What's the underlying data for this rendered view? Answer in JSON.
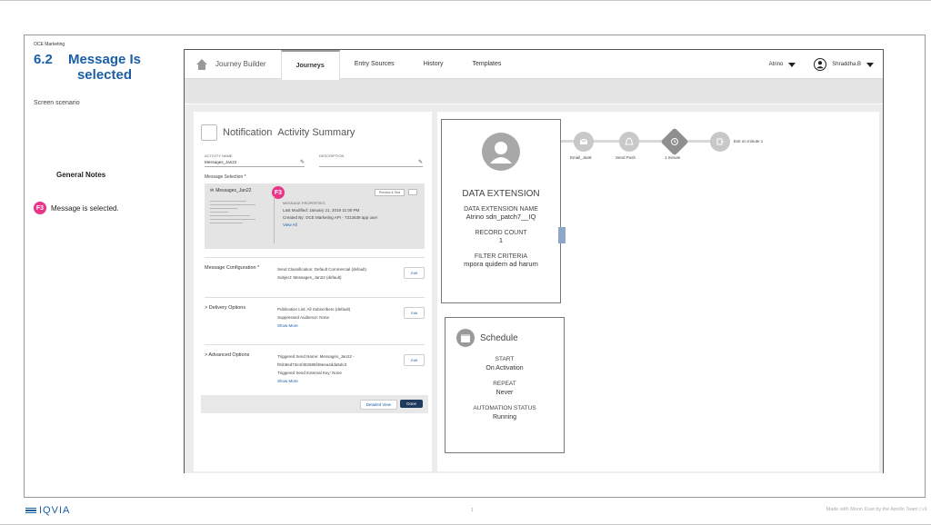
{
  "slide": {
    "app_name": "OCE Marketing",
    "number": "6.2",
    "title": "Message Is selected",
    "scenario": "Screen scenario",
    "general_notes": "General Notes",
    "note_badge": "F3",
    "note_text": "Message is selected.",
    "page_num": "1",
    "made_with": "Made with Moon Dust by the Apollo Team  |  v1",
    "logo_text": "IQVIA"
  },
  "nav": {
    "brand": "Journey Builder",
    "tabs": [
      "Journeys",
      "Entry Sources",
      "History",
      "Templates"
    ],
    "active_tab": "Journeys",
    "org": "Atrino",
    "user": "Shraddha.B"
  },
  "summary": {
    "title_light": "Notification",
    "title": "Activity Summary",
    "activity_name_label": "ACTIVITY NAME",
    "activity_name": "Messages_Jan22",
    "description_label": "DESCRIPTION",
    "description": "",
    "message_selection_label": "Message Selection *",
    "message_name": "Messages_Jan22",
    "badge": "F3",
    "preview_label": "Preview & Test",
    "props_heading": "MESSAGE PROPERTIES",
    "last_modified": "Last Modified: January 21, 2019 11:00 PM",
    "created_by": "Created By: OCE Marketing API - 7312639 app user",
    "view_all": "View All",
    "config_label": "Message Configuration *",
    "send_class": "Send Classification: Default Commercial (default)",
    "subject": "Subject: Messages_Jan22 (default)",
    "delivery_label": "> Delivery Options",
    "publication": "Publication List: All Subscribers (default)",
    "suppressed": "Suppressed Audience: None",
    "show_more_1": "Show More",
    "advanced_label": "> Advanced Options",
    "triggered_name": "Triggered Send Name: Messages_Jan22 -",
    "triggered_id": "f91b9ed73e1f482685f48eea4dda5dc3",
    "triggered_key": "Triggered Send External Key: None",
    "show_more_2": "Show More",
    "edit": "Edit",
    "detailed_view": "Detailed View",
    "done": "Done"
  },
  "canvas": {
    "de_title": "DATA EXTENSION",
    "de_name_label": "DATA EXTENSION NAME",
    "de_name": "Atrino sdn_patch7__IQ",
    "record_count_label": "RECORD COUNT",
    "record_count": "1",
    "filter_label": "FILTER CRITERIA",
    "filter_value": "mpora quidem ad harum",
    "flow": {
      "email": "Email_Jan8",
      "push": "Send Push",
      "wait": "1 minute",
      "exit": "Exit on minute 1"
    },
    "schedule_title": "Schedule",
    "start_label": "START",
    "start_value": "On Activation",
    "repeat_label": "REPEAT",
    "repeat_value": "Never",
    "status_label": "AUTOMATION STATUS",
    "status_value": "Running"
  },
  "colors": {
    "brand_blue": "#1a5ea6",
    "badge_pink": "#e8358a",
    "done_navy": "#1e3a5e"
  }
}
